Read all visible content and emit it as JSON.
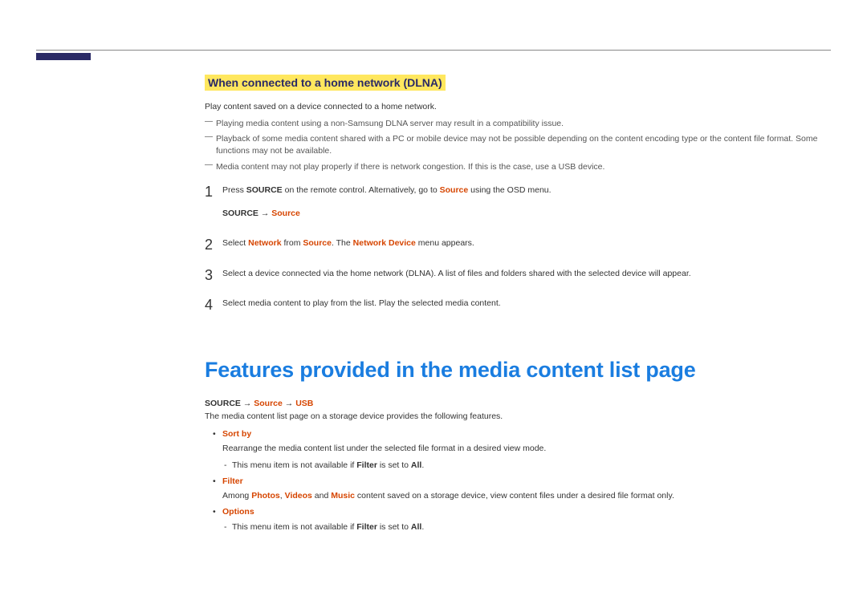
{
  "section1": {
    "heading": "When connected to a home network (DLNA)",
    "intro": "Play content saved on a device connected to a home network.",
    "notes": [
      "Playing media content using a non-Samsung DLNA server may result in a compatibility issue.",
      "Playback of some media content shared with a PC or mobile device may not be possible depending on the content encoding type or the content file format. Some functions may not be available.",
      "Media content may not play properly if there is network congestion. If this is the case, use a USB device."
    ],
    "step1": {
      "a": "Press ",
      "b": "SOURCE",
      "c": " on the remote control. Alternatively, go to ",
      "d": "Source",
      "e": " using the OSD menu.",
      "path_a": "SOURCE ",
      "path_arrow": "→ ",
      "path_b": "Source"
    },
    "step2": {
      "a": "Select ",
      "b": "Network",
      "c": " from ",
      "d": "Source",
      "e": ". The ",
      "f": "Network Device",
      "g": " menu appears."
    },
    "step3": "Select a device connected via the home network (DLNA). A list of files and folders shared with the selected device will appear.",
    "step4": "Select media content to play from the list. Play the selected media content.",
    "nums": {
      "n1": "1",
      "n2": "2",
      "n3": "3",
      "n4": "4"
    }
  },
  "section2": {
    "heading": "Features provided in the media content list page",
    "path": {
      "a": "SOURCE ",
      "arr1": "→ ",
      "b": "Source",
      "arr2": " → ",
      "c": "USB"
    },
    "intro": "The media content list page on a storage device provides the following features.",
    "sortby": {
      "title": "Sort by",
      "desc": "Rearrange the media content list under the selected file format in a desired view mode.",
      "note_a": "This menu item is not available if ",
      "note_b": "Filter",
      "note_c": " is set to ",
      "note_d": "All",
      "note_e": "."
    },
    "filter": {
      "title": "Filter",
      "desc_a": "Among ",
      "desc_b": "Photos",
      "desc_c": ", ",
      "desc_d": "Videos",
      "desc_e": " and ",
      "desc_f": "Music",
      "desc_g": " content saved on a storage device, view content files under a desired file format only."
    },
    "options": {
      "title": "Options",
      "note_a": "This menu item is not available if ",
      "note_b": "Filter",
      "note_c": " is set to ",
      "note_d": "All",
      "note_e": "."
    }
  }
}
